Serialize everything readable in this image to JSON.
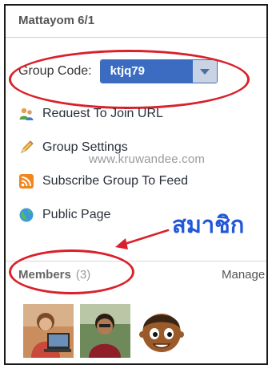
{
  "panel": {
    "title": "Mattayom 6/1"
  },
  "group_code": {
    "label": "Group Code:",
    "value": "ktjq79"
  },
  "menu": [
    {
      "label": "Request To Join URL",
      "icon": "request-join-people-icon"
    },
    {
      "label": "Group Settings",
      "icon": "pencil-icon"
    },
    {
      "label": "Subscribe Group To Feed",
      "icon": "rss-feed-icon"
    },
    {
      "label": "Public Page",
      "icon": "globe-icon"
    }
  ],
  "watermark": "www.kruwandee.com",
  "annotation": {
    "text": "สมาชิก",
    "color": "#2257d8",
    "marker_color": "#d9212b"
  },
  "members": {
    "title": "Members",
    "count": "(3)",
    "manage_label": "Manage"
  },
  "colors": {
    "accent": "#3b6cc2",
    "link_text": "#2a2f3a",
    "annotation_red": "#d9212b"
  }
}
